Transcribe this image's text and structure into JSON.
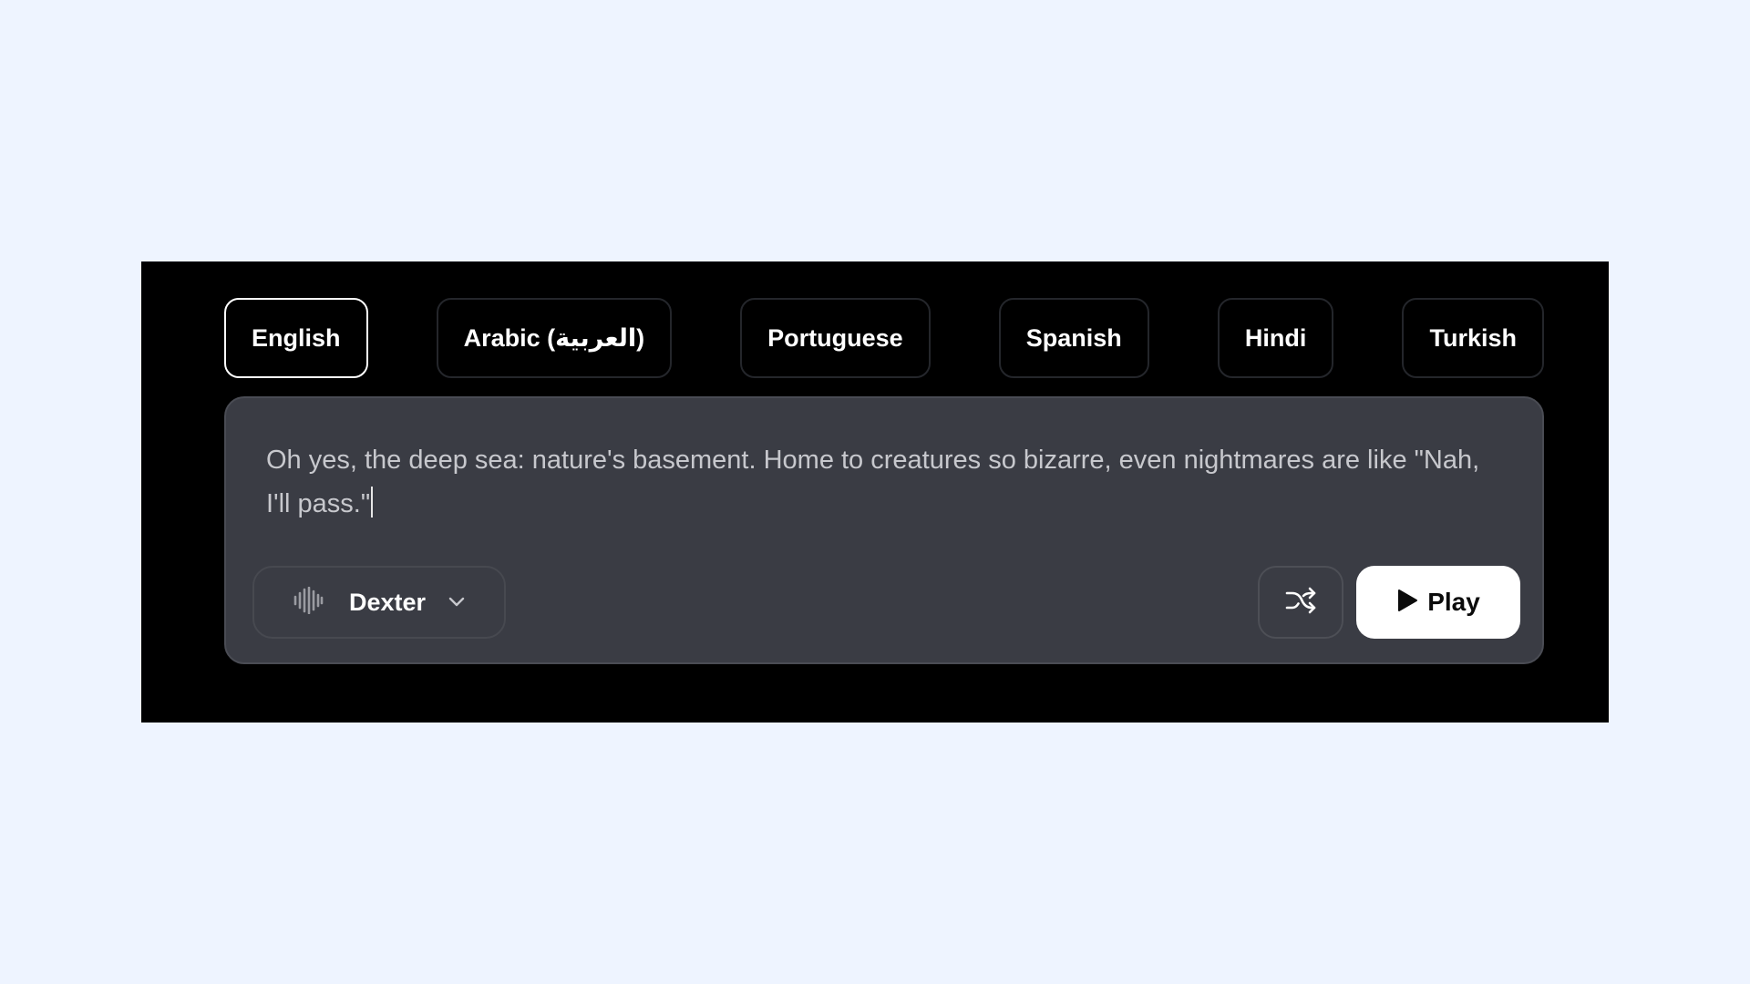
{
  "languages": [
    {
      "label": "English",
      "selected": true
    },
    {
      "label": "Arabic (العربية)",
      "selected": false
    },
    {
      "label": "Portuguese",
      "selected": false
    },
    {
      "label": "Spanish",
      "selected": false
    },
    {
      "label": "Hindi",
      "selected": false
    },
    {
      "label": "Turkish",
      "selected": false
    }
  ],
  "editor": {
    "text": "Oh yes, the deep sea: nature's basement. Home to creatures so bizarre, even nightmares are like \"Nah, I'll pass.\""
  },
  "voice": {
    "name": "Dexter",
    "icon": "waveform-icon"
  },
  "controls": {
    "shuffle_icon": "shuffle-icon",
    "play_label": "Play",
    "play_icon": "play-icon"
  },
  "colors": {
    "background": "#eef4ff",
    "panel": "#000000",
    "card": "#3a3c44",
    "text": "#c7c8cd",
    "play_button": "#ffffff"
  }
}
